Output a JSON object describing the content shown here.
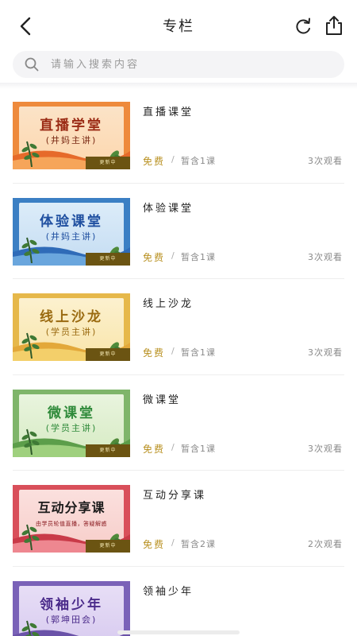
{
  "header": {
    "title": "专栏",
    "icons": {
      "back": "chevron-left-icon",
      "refresh": "refresh-icon",
      "share": "share-icon"
    }
  },
  "search": {
    "placeholder": "请输入搜索内容",
    "value": ""
  },
  "colors": {
    "price": "#b89020",
    "badge": "#6b5412"
  },
  "courses": [
    {
      "title": "直播课堂",
      "cover_title": "直播学堂",
      "cover_sub": "(井妈主讲)",
      "badge": "更新中",
      "price": "免费",
      "sep": "/",
      "lessons": "暂含1课",
      "views": "3次观看",
      "theme": "orange"
    },
    {
      "title": "体验课堂",
      "cover_title": "体验课堂",
      "cover_sub": "(井妈主讲)",
      "badge": "更新中",
      "price": "免费",
      "sep": "/",
      "lessons": "暂含1课",
      "views": "3次观看",
      "theme": "blue"
    },
    {
      "title": "线上沙龙",
      "cover_title": "线上沙龙",
      "cover_sub": "(学员主讲)",
      "badge": "更新中",
      "price": "免费",
      "sep": "/",
      "lessons": "暂含1课",
      "views": "3次观看",
      "theme": "yellow"
    },
    {
      "title": "微课堂",
      "cover_title": "微课堂",
      "cover_sub": "(学员主讲)",
      "badge": "更新中",
      "price": "免费",
      "sep": "/",
      "lessons": "暂含1课",
      "views": "3次观看",
      "theme": "green"
    },
    {
      "title": "互动分享课",
      "cover_title": "互动分享课",
      "cover_sub": "由学员轮值直播，答疑解惑",
      "badge": "更新中",
      "price": "免费",
      "sep": "/",
      "lessons": "暂含2课",
      "views": "2次观看",
      "theme": "red"
    },
    {
      "title": "领袖少年",
      "cover_title": "领袖少年",
      "cover_sub": "(郭坤田会)",
      "badge": "",
      "price": "",
      "sep": "",
      "lessons": "",
      "views": "",
      "theme": "purple"
    }
  ]
}
